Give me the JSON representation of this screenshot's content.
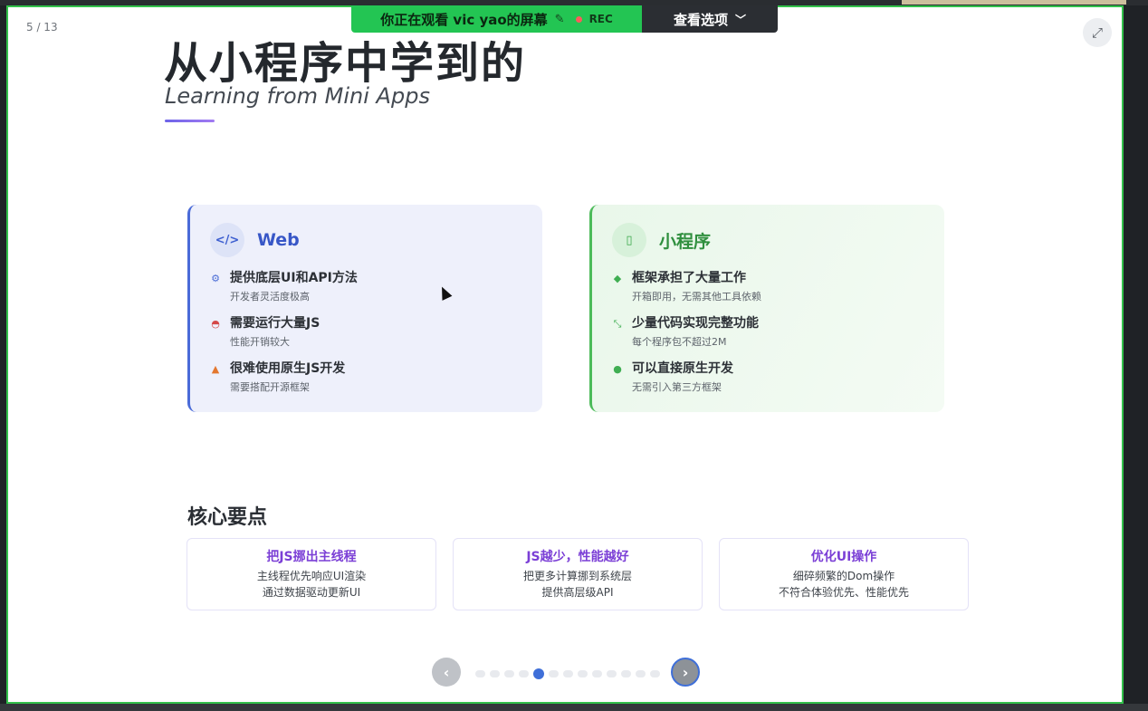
{
  "share_bar": {
    "viewing_text": "你正在观看 vic yao的屏幕",
    "rec_label": "REC",
    "options_label": "查看选项"
  },
  "slide": {
    "counter": "5 / 13",
    "title": "从小程序中学到的",
    "subtitle": "Learning from Mini Apps",
    "web_card": {
      "icon_text": "</>",
      "title": "Web",
      "items": [
        {
          "icon": "gears-icon",
          "main": "提供底层UI和API方法",
          "sub": "开发者灵活度极高"
        },
        {
          "icon": "gauge-icon",
          "main": "需要运行大量JS",
          "sub": "性能开销较大"
        },
        {
          "icon": "warning-icon",
          "main": "很难使用原生JS开发",
          "sub": "需要搭配开源框架"
        }
      ]
    },
    "mini_card": {
      "icon_text": "▯",
      "title": "小程序",
      "items": [
        {
          "icon": "cube-icon",
          "main": "框架承担了大量工作",
          "sub": "开箱即用，无需其他工具依赖"
        },
        {
          "icon": "compress-icon",
          "main": "少量代码实现完整功能",
          "sub": "每个程序包不超过2M"
        },
        {
          "icon": "check-circle-icon",
          "main": "可以直接原生开发",
          "sub": "无需引入第三方框架"
        }
      ]
    },
    "section_title": "核心要点",
    "points": [
      {
        "title": "把JS挪出主线程",
        "line1": "主线程优先响应UI渲染",
        "line2": "通过数据驱动更新UI"
      },
      {
        "title": "JS越少，性能越好",
        "line1": "把更多计算挪到系统层",
        "line2": "提供高层级API"
      },
      {
        "title": "优化UI操作",
        "line1": "细碎频繁的Dom操作",
        "line2": "不符合体验优先、性能优先"
      }
    ]
  },
  "pager": {
    "prev_icon": "‹",
    "next_icon": "›",
    "total": 13,
    "current": 5
  },
  "colors": {
    "share_green": "#23c553",
    "frame_green": "#33c14b",
    "web_accent": "#3857c7",
    "mini_accent": "#2f8f3e",
    "point_title": "#7b3fd6",
    "pager_active": "#3f6fd8"
  }
}
